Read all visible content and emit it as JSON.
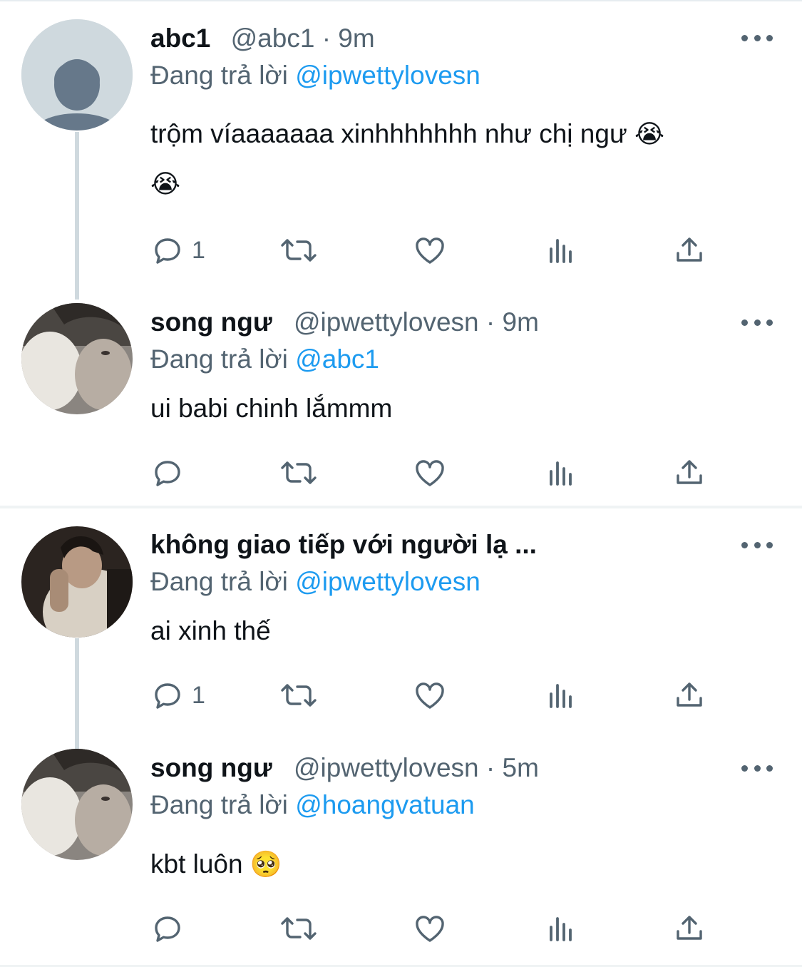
{
  "tweets": [
    {
      "name": "abc1",
      "handle": "@abc1 · 9m",
      "replying_prefix": "Đang trả lời ",
      "replying_to": "@ipwettylovesn",
      "text": "trộm víaaaaaaa xinhhhhhhh như chị ngư ",
      "emoji": "😭",
      "text_line2_emoji": "😭",
      "reply_count": "1",
      "avatar_icon": "default-person-icon"
    },
    {
      "name": "song ngư",
      "handle": "@ipwettylovesn · 9m",
      "replying_prefix": "Đang trả lời ",
      "replying_to": "@abc1",
      "text": "ui babi chinh lắmmm",
      "reply_count": "",
      "avatar_icon": "photo-avatar"
    },
    {
      "name": "không giao tiếp với người lạ ...",
      "handle": "",
      "replying_prefix": "Đang trả lời ",
      "replying_to": "@ipwettylovesn",
      "text": "ai xinh thế",
      "reply_count": "1",
      "avatar_icon": "photo-avatar"
    },
    {
      "name": "song ngư",
      "handle": "@ipwettylovesn · 5m",
      "replying_prefix": "Đang trả lời ",
      "replying_to": "@hoangvatuan",
      "text": "kbt luôn ",
      "emoji": "🥺",
      "reply_count": "",
      "avatar_icon": "photo-avatar"
    }
  ],
  "colors": {
    "accent": "#1d9bf0",
    "secondary_text": "#536471",
    "thread_line": "#cfd9de"
  },
  "icons": [
    "reply-icon",
    "retweet-icon",
    "like-icon",
    "views-icon",
    "share-icon",
    "more-icon"
  ]
}
